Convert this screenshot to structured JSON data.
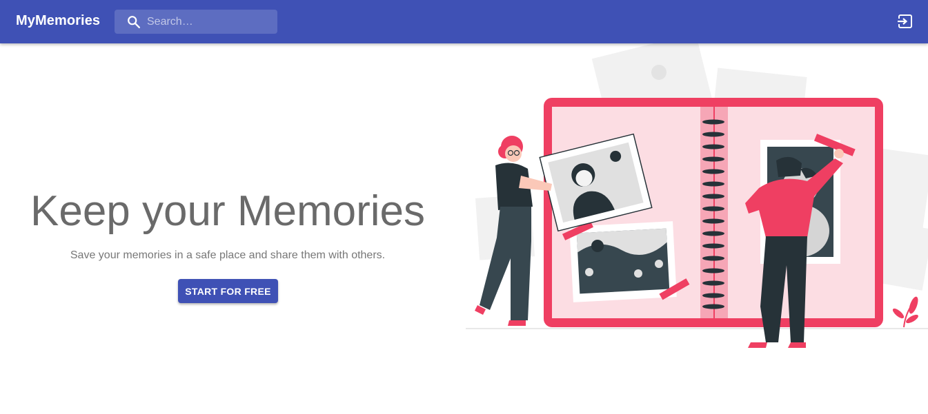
{
  "appbar": {
    "brand": "MyMemories",
    "search": {
      "placeholder": "Search…",
      "icon": "search-icon"
    },
    "login_icon": "login-icon",
    "color": "#3f51b5"
  },
  "hero": {
    "title": "Keep your Memories",
    "subtitle": "Save your memories in a safe place and share them with others.",
    "cta_label": "START FOR FREE"
  },
  "illustration": {
    "accent": "#ef3f62",
    "dark": "#263238"
  }
}
